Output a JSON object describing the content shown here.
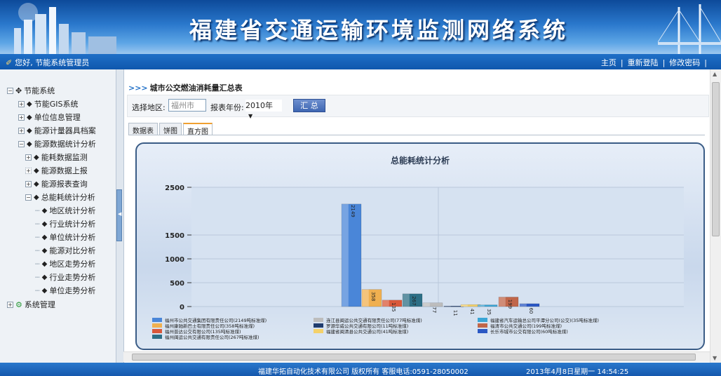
{
  "banner": {
    "title": "福建省交通运输环境监测网络系统"
  },
  "topbar": {
    "greeting": "您好, 节能系统管理员",
    "links": [
      "主页",
      "重新登陆",
      "修改密码"
    ]
  },
  "sidebar": {
    "root": "节能系统",
    "items": [
      {
        "label": "节能GIS系统"
      },
      {
        "label": "单位信息管理"
      },
      {
        "label": "能源计量器具档案"
      },
      {
        "label": "能源数据统计分析"
      },
      {
        "label": "能耗数据监测"
      },
      {
        "label": "能源数据上报"
      },
      {
        "label": "能源报表查询"
      },
      {
        "label": "总能耗统计分析"
      },
      {
        "label": "地区统计分析"
      },
      {
        "label": "行业统计分析"
      },
      {
        "label": "单位统计分析"
      },
      {
        "label": "能源对比分析"
      },
      {
        "label": "地区走势分析"
      },
      {
        "label": "行业走势分析"
      },
      {
        "label": "单位走势分析"
      },
      {
        "label": "系统管理"
      }
    ]
  },
  "main": {
    "breadcrumb": "城市公交燃油消耗量汇总表",
    "filter": {
      "region_label": "选择地区:",
      "region_value": "福州市",
      "year_label": "报表年份:",
      "year_value": "2010年",
      "submit_label": "汇 总"
    },
    "tabs": [
      "数据表",
      "饼图",
      "直方图"
    ],
    "active_tab": 2
  },
  "chart_data": {
    "type": "bar",
    "title": "总能耗统计分析",
    "ylim": [
      0,
      2500
    ],
    "yticks": [
      "0",
      "500",
      "1000",
      "1500",
      "2500"
    ],
    "series": [
      {
        "name": "福州市公共交通集团有限责任公司(2149吨标准煤)",
        "value": 2149,
        "label": "2149",
        "color": "#4a86d8"
      },
      {
        "name": "福州康驰新巴士有限责任公司(358吨标准煤)",
        "value": 358,
        "label": "358",
        "color": "#f0b050"
      },
      {
        "name": "福州普达公交有限公司(135吨标准煤)",
        "value": 135,
        "label": "135",
        "color": "#d9583a"
      },
      {
        "name": "福州闽运公共交通有限责任公司(267吨标准煤)",
        "value": 267,
        "label": "267",
        "color": "#2d6f86"
      },
      {
        "name": "连江县闽运公共交通有限责任公司(77吨标准煤)",
        "value": 77,
        "label": "77",
        "color": "#bdbdbd"
      },
      {
        "name": "罗源华威公共交通有限公司(11吨标准煤)",
        "value": 11,
        "label": "11",
        "color": "#1f3c6e"
      },
      {
        "name": "福建省闽清县公共交通公司(41吨标准煤)",
        "value": 41,
        "label": "41",
        "color": "#f4d16a"
      },
      {
        "name": "福建省汽车运输总公司平潭分公司(公交)(35吨标准煤)",
        "value": 35,
        "label": "35",
        "color": "#3aa5d6"
      },
      {
        "name": "福清市公共交通公司(199吨标准煤)",
        "value": 199,
        "label": "199",
        "color": "#c0664a"
      },
      {
        "name": "长乐市城市公交有限公司(60吨标准煤)",
        "value": 60,
        "label": "60",
        "color": "#2b58c4"
      }
    ]
  },
  "footer": {
    "copyright": "福建华拓自动化技术有限公司  版权所有    客服电话:0591-28050002",
    "datetime": "2013年4月8日星期一 14:54:25"
  }
}
